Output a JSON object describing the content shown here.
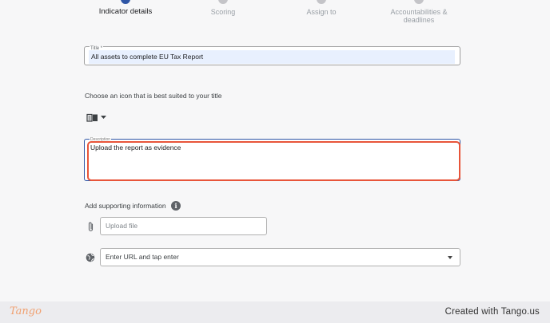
{
  "stepper": {
    "steps": [
      {
        "label": "Indicator details",
        "active": true
      },
      {
        "label": "Scoring",
        "active": false
      },
      {
        "label": "Assign to",
        "active": false
      },
      {
        "label": "Accountabilities & deadlines",
        "label_line1": "Accountabilities &",
        "label_line2": "deadlines",
        "active": false
      }
    ]
  },
  "form": {
    "title_label": "Title *",
    "title_value": "All assets to complete EU Tax Report",
    "icon_prompt": "Choose an icon that is best suited to your title",
    "selected_icon": "book-icon",
    "description_label": "Description",
    "description_value": "Upload the report as evidence",
    "supporting_label": "Add supporting information",
    "upload_placeholder": "Upload file",
    "url_placeholder": "Enter URL and tap enter"
  },
  "footer": {
    "logo": "Tango",
    "created_with": "Created with Tango.us"
  },
  "colors": {
    "accent": "#2f56a6",
    "highlight": "#e8553a",
    "title_fill": "#e8f0fe",
    "brand": "#f0a070"
  }
}
